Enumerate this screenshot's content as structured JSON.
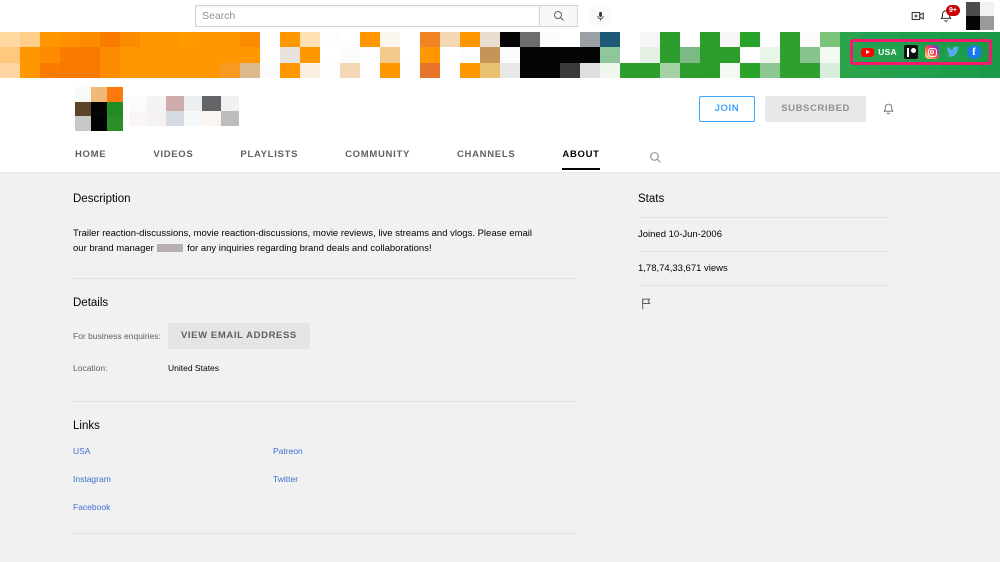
{
  "masthead": {
    "search": {
      "placeholder": "Search",
      "value": "",
      "search_icon": "search-icon",
      "mic_icon": "microphone-icon"
    },
    "create_icon": "create-video-icon",
    "notifications_icon": "notifications-bell-icon",
    "notifications_badge": "9+",
    "account_avatar": "account-avatar-redacted"
  },
  "banner": {
    "alt": "channel-banner-pixelated",
    "highlight_color": "#f5186c",
    "links": [
      {
        "label": "USA",
        "icon": "youtube-icon"
      },
      {
        "label": "",
        "icon": "patreon-icon"
      },
      {
        "label": "",
        "icon": "instagram-icon"
      },
      {
        "label": "",
        "icon": "twitter-icon"
      },
      {
        "label": "",
        "icon": "facebook-icon"
      }
    ]
  },
  "channel": {
    "avatar": "channel-avatar-redacted",
    "name": "channel-name-redacted",
    "join_label": "JOIN",
    "subscribed_label": "SUBSCRIBED",
    "bell_icon": "notification-bell-icon",
    "tabs": [
      {
        "label": "HOME",
        "active": false
      },
      {
        "label": "VIDEOS",
        "active": false
      },
      {
        "label": "PLAYLISTS",
        "active": false
      },
      {
        "label": "COMMUNITY",
        "active": false
      },
      {
        "label": "CHANNELS",
        "active": false
      },
      {
        "label": "ABOUT",
        "active": true
      }
    ],
    "tab_search_icon": "search-icon"
  },
  "about": {
    "description": {
      "title": "Description",
      "text_before": "Trailer reaction-discussions, movie reaction-discussions, movie reviews, live streams and vlogs.  Please email our brand manager ",
      "text_after": " for any inquiries regarding brand deals and collaborations!"
    },
    "details": {
      "title": "Details",
      "business_label": "For business enquiries:",
      "email_button": "VIEW EMAIL ADDRESS",
      "location_label": "Location:",
      "location_value": "United States"
    },
    "links": {
      "title": "Links",
      "column_left": [
        "USA",
        "Instagram",
        "Facebook"
      ],
      "column_right": [
        "Patreon",
        "Twitter"
      ]
    },
    "stats": {
      "title": "Stats",
      "joined": "Joined 10-Jun-2006",
      "views": "1,78,74,33,671 views",
      "report_icon": "report-flag-icon"
    }
  }
}
